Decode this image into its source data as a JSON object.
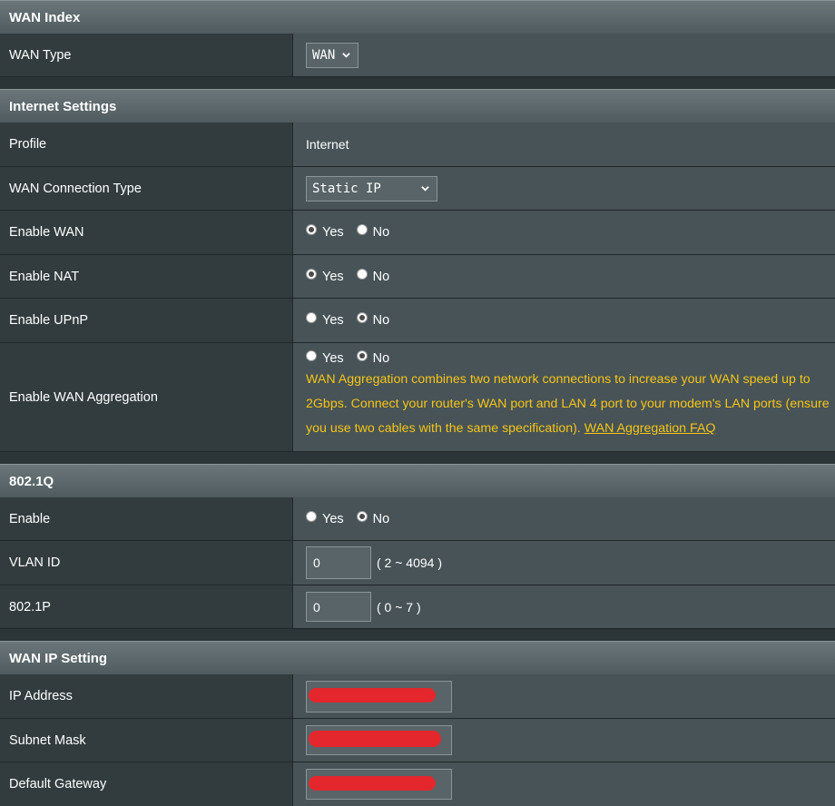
{
  "wan_index": {
    "header": "WAN Index",
    "wan_type_label": "WAN Type",
    "wan_type_value": "WAN"
  },
  "internet_settings": {
    "header": "Internet Settings",
    "profile_label": "Profile",
    "profile_value": "Internet",
    "connection_type_label": "WAN Connection Type",
    "connection_type_value": "Static IP",
    "enable_wan_label": "Enable WAN",
    "enable_nat_label": "Enable NAT",
    "enable_upnp_label": "Enable UPnP",
    "aggregation_label": "Enable WAN Aggregation",
    "aggregation_note": "WAN Aggregation combines two network connections to increase your WAN speed up to 2Gbps. Connect your router's WAN port and LAN 4 port to your modem's LAN ports (ensure you use two cables with the same specification).",
    "aggregation_faq": "WAN Aggregation FAQ"
  },
  "radio": {
    "yes": "Yes",
    "no": "No"
  },
  "dot1q": {
    "header": "802.1Q",
    "enable_label": "Enable",
    "vlan_label": "VLAN ID",
    "vlan_value": "0",
    "vlan_range": "( 2 ~ 4094 )",
    "p_label": "802.1P",
    "p_value": "0",
    "p_range": "( 0 ~ 7 )"
  },
  "wan_ip": {
    "header": "WAN IP Setting",
    "ip_label": "IP Address",
    "mask_label": "Subnet Mask",
    "gateway_label": "Default Gateway"
  },
  "colors": {
    "note_text": "#f5c518",
    "redaction": "#e4262d"
  }
}
